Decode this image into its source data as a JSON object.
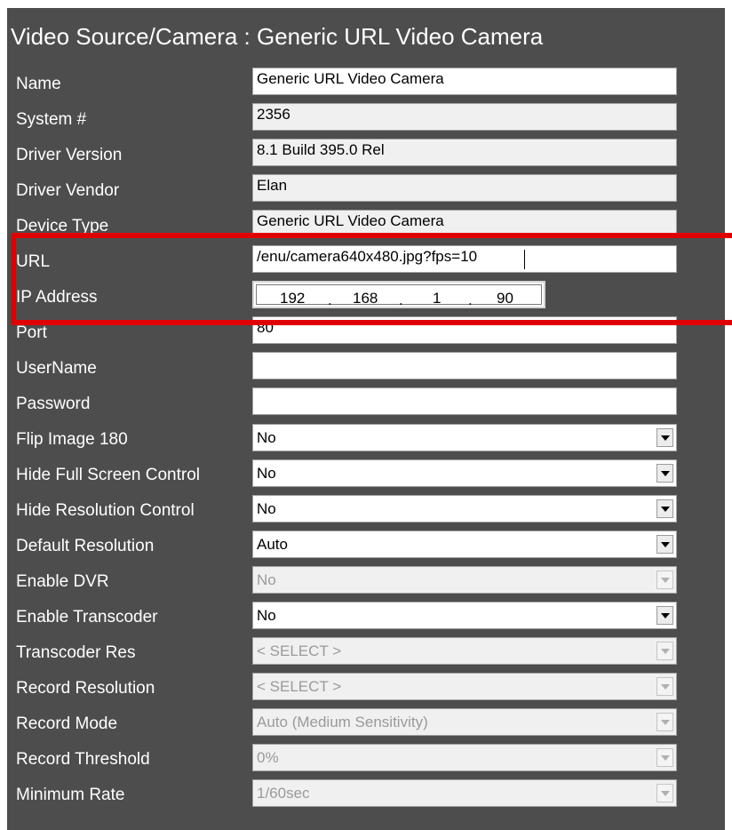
{
  "title": "Video Source/Camera : Generic URL Video Camera",
  "fields": {
    "name": {
      "label": "Name",
      "value": "Generic URL Video Camera"
    },
    "system_number": {
      "label": "System #",
      "value": "2356"
    },
    "driver_version": {
      "label": "Driver Version",
      "value": "8.1 Build 395.0 Rel"
    },
    "driver_vendor": {
      "label": "Driver Vendor",
      "value": "Elan"
    },
    "device_type": {
      "label": "Device Type",
      "value": "Generic URL Video Camera"
    },
    "url": {
      "label": "URL",
      "value": "/enu/camera640x480.jpg?fps=10"
    },
    "ip_address": {
      "label": "IP Address",
      "octets": [
        "192",
        "168",
        "1",
        "90"
      ],
      "separator": "."
    },
    "port": {
      "label": "Port",
      "value": "80"
    },
    "username": {
      "label": "UserName",
      "value": ""
    },
    "password": {
      "label": "Password",
      "value": ""
    }
  },
  "dropdowns": {
    "flip_image": {
      "label": "Flip Image 180",
      "value": "No"
    },
    "hide_full_screen": {
      "label": "Hide Full Screen Control",
      "value": "No"
    },
    "hide_resolution": {
      "label": "Hide Resolution Control",
      "value": "No"
    },
    "default_resolution": {
      "label": "Default Resolution",
      "value": "Auto"
    },
    "enable_dvr": {
      "label": "Enable DVR",
      "value": "No",
      "disabled": true
    },
    "enable_transcoder": {
      "label": "Enable Transcoder",
      "value": "No"
    },
    "transcoder_res": {
      "label": "Transcoder Res",
      "value": "< SELECT >",
      "disabled": true
    },
    "record_resolution": {
      "label": "Record Resolution",
      "value": "< SELECT >",
      "disabled": true
    },
    "record_mode": {
      "label": "Record Mode",
      "value": "Auto (Medium Sensitivity)",
      "disabled": true
    },
    "record_threshold": {
      "label": "Record Threshold",
      "value": "0%",
      "disabled": true
    },
    "minimum_rate": {
      "label": "Minimum Rate",
      "value": "1/60sec",
      "disabled": true
    }
  },
  "icons": {
    "dropdown_arrow": "chevron-down-icon"
  },
  "colors": {
    "panel": "#4d4d4d",
    "highlight": "#e00000",
    "label_text": "#ffffff"
  }
}
